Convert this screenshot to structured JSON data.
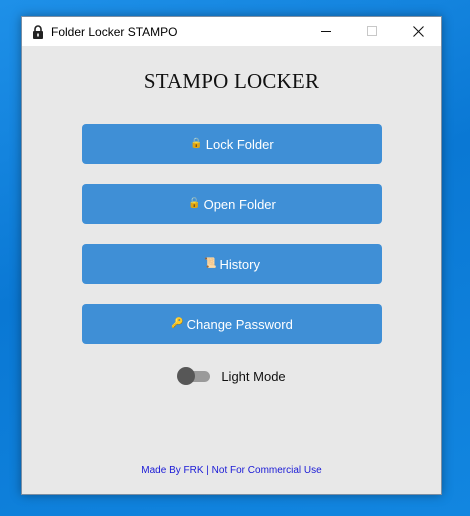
{
  "window": {
    "title": "Folder Locker STAMPO",
    "icons": {
      "app": "padlock-icon",
      "minimize": "minimize-icon",
      "maximize": "maximize-icon",
      "close": "close-icon"
    }
  },
  "main": {
    "heading": "STAMPO LOCKER",
    "buttons": [
      {
        "label": "Lock Folder",
        "icon": "lock-icon",
        "glyph": "🔒"
      },
      {
        "label": "Open Folder",
        "icon": "unlock-icon",
        "glyph": "🔓"
      },
      {
        "label": "History",
        "icon": "scroll-icon",
        "glyph": "📜"
      },
      {
        "label": "Change Password",
        "icon": "key-icon",
        "glyph": "🔑"
      }
    ],
    "toggle": {
      "label": "Light Mode",
      "state": "off"
    }
  },
  "footer": {
    "text": "Made By FRK | Not For Commercial Use"
  },
  "colors": {
    "button_bg": "#3f8fd6",
    "window_bg": "#e8e8e8",
    "desktop_bg": "#0a78d4",
    "footer_link": "#1a1ad6"
  }
}
